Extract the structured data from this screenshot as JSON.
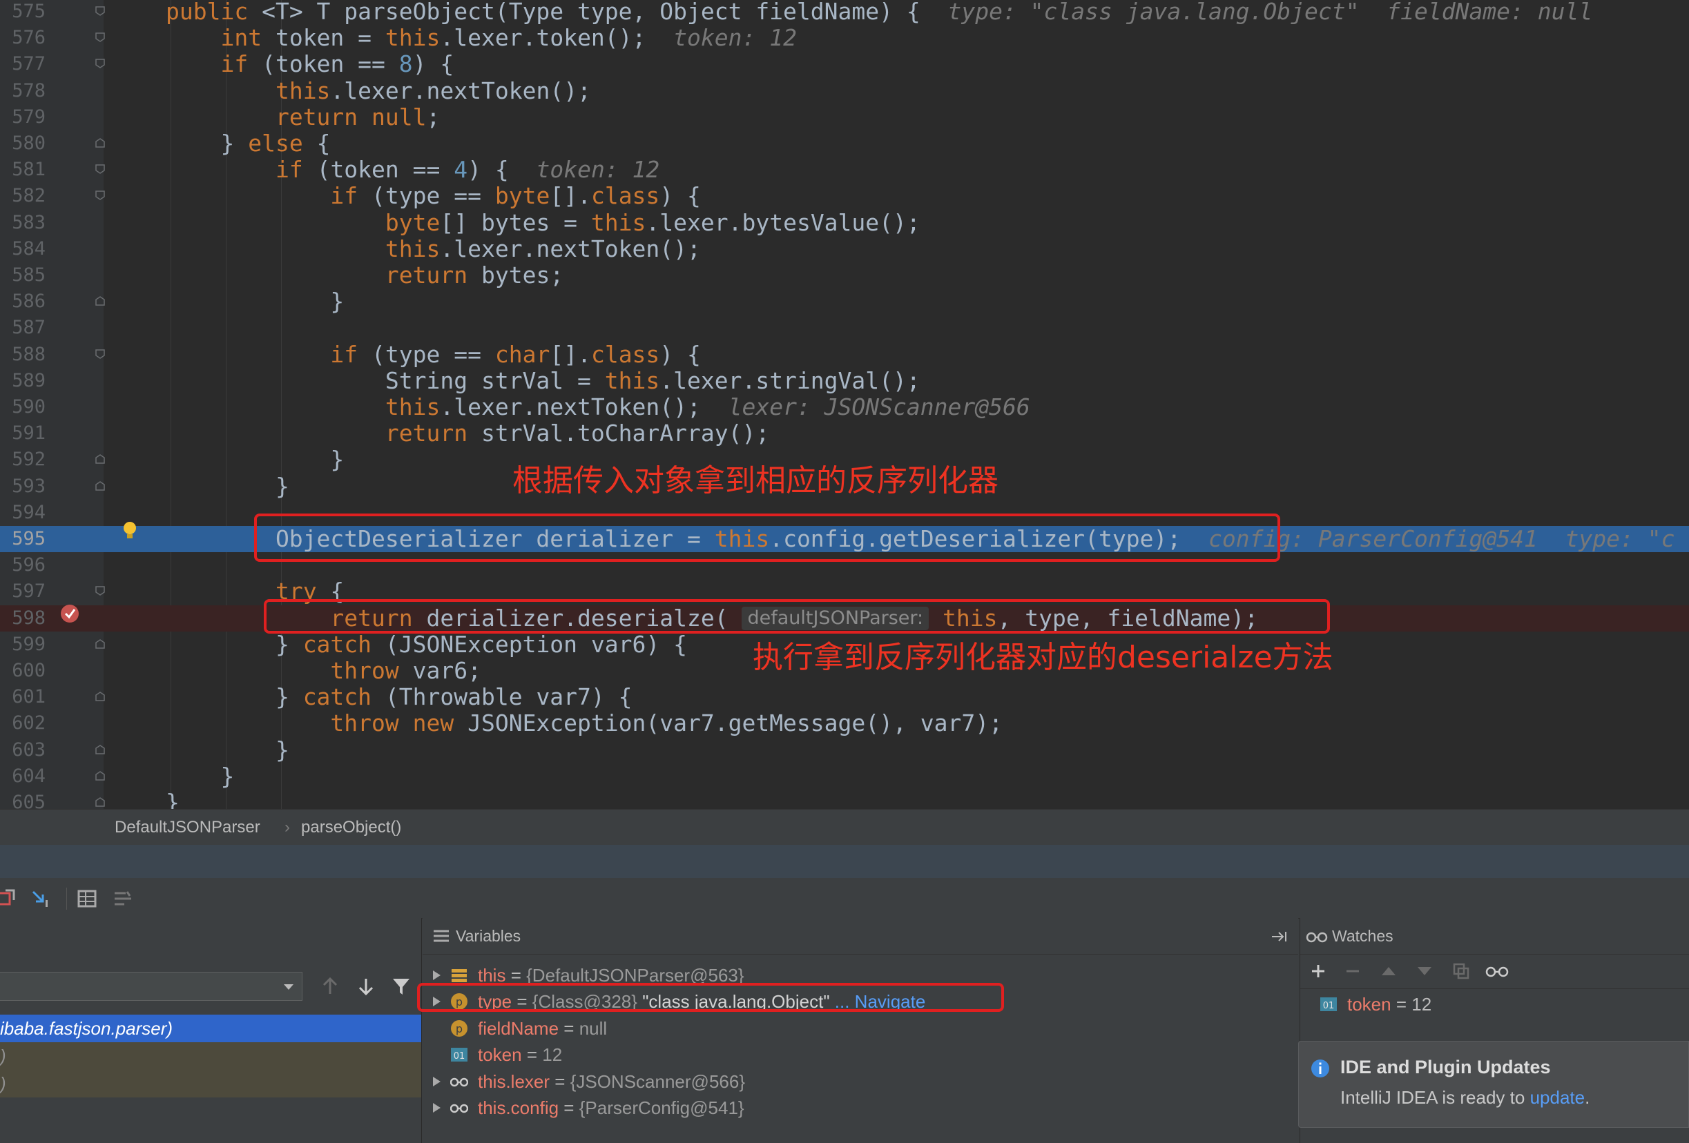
{
  "editor": {
    "lines": [
      {
        "n": "575",
        "tokens": [
          [
            "kw",
            "public "
          ],
          [
            "pl",
            "<T> T parseObject(Type type, Object fieldName) {  "
          ],
          [
            "hint",
            "type: \"class java.lang.Object\"  fieldName: null"
          ]
        ]
      },
      {
        "n": "576",
        "tokens": [
          [
            "pl",
            "    "
          ],
          [
            "kw",
            "int"
          ],
          [
            "pl",
            " token = "
          ],
          [
            "kw",
            "this"
          ],
          [
            "pl",
            ".lexer.token();  "
          ],
          [
            "hint",
            "token: 12"
          ]
        ]
      },
      {
        "n": "577",
        "tokens": [
          [
            "pl",
            "    "
          ],
          [
            "kw",
            "if"
          ],
          [
            "pl",
            " (token == "
          ],
          [
            "num",
            "8"
          ],
          [
            "pl",
            ") {"
          ]
        ]
      },
      {
        "n": "578",
        "tokens": [
          [
            "pl",
            "        "
          ],
          [
            "kw",
            "this"
          ],
          [
            "pl",
            ".lexer.nextToken();"
          ]
        ]
      },
      {
        "n": "579",
        "tokens": [
          [
            "pl",
            "        "
          ],
          [
            "kw",
            "return null"
          ],
          [
            "pl",
            ";"
          ]
        ]
      },
      {
        "n": "580",
        "tokens": [
          [
            "pl",
            "    } "
          ],
          [
            "kw",
            "else"
          ],
          [
            "pl",
            " {"
          ]
        ]
      },
      {
        "n": "581",
        "tokens": [
          [
            "pl",
            "        "
          ],
          [
            "kw",
            "if"
          ],
          [
            "pl",
            " (token == "
          ],
          [
            "num",
            "4"
          ],
          [
            "pl",
            ") {  "
          ],
          [
            "hint",
            "token: 12"
          ]
        ]
      },
      {
        "n": "582",
        "tokens": [
          [
            "pl",
            "            "
          ],
          [
            "kw",
            "if"
          ],
          [
            "pl",
            " (type == "
          ],
          [
            "kw",
            "byte"
          ],
          [
            "pl",
            "[]."
          ],
          [
            "kw",
            "class"
          ],
          [
            "pl",
            ") {"
          ]
        ]
      },
      {
        "n": "583",
        "tokens": [
          [
            "pl",
            "                "
          ],
          [
            "kw",
            "byte"
          ],
          [
            "pl",
            "[] bytes = "
          ],
          [
            "kw",
            "this"
          ],
          [
            "pl",
            ".lexer.bytesValue();"
          ]
        ]
      },
      {
        "n": "584",
        "tokens": [
          [
            "pl",
            "                "
          ],
          [
            "kw",
            "this"
          ],
          [
            "pl",
            ".lexer.nextToken();"
          ]
        ]
      },
      {
        "n": "585",
        "tokens": [
          [
            "pl",
            "                "
          ],
          [
            "kw",
            "return"
          ],
          [
            "pl",
            " bytes;"
          ]
        ]
      },
      {
        "n": "586",
        "tokens": [
          [
            "pl",
            "            }"
          ]
        ]
      },
      {
        "n": "587",
        "tokens": []
      },
      {
        "n": "588",
        "tokens": [
          [
            "pl",
            "            "
          ],
          [
            "kw",
            "if"
          ],
          [
            "pl",
            " (type == "
          ],
          [
            "kw",
            "char"
          ],
          [
            "pl",
            "[]."
          ],
          [
            "kw",
            "class"
          ],
          [
            "pl",
            ") {"
          ]
        ]
      },
      {
        "n": "589",
        "tokens": [
          [
            "pl",
            "                String strVal = "
          ],
          [
            "kw",
            "this"
          ],
          [
            "pl",
            ".lexer.stringVal();"
          ]
        ]
      },
      {
        "n": "590",
        "tokens": [
          [
            "pl",
            "                "
          ],
          [
            "kw",
            "this"
          ],
          [
            "pl",
            ".lexer.nextToken();  "
          ],
          [
            "hint",
            "lexer: JSONScanner@566"
          ]
        ]
      },
      {
        "n": "591",
        "tokens": [
          [
            "pl",
            "                "
          ],
          [
            "kw",
            "return"
          ],
          [
            "pl",
            " strVal.toCharArray();"
          ]
        ]
      },
      {
        "n": "592",
        "tokens": [
          [
            "pl",
            "            }"
          ]
        ]
      },
      {
        "n": "593",
        "tokens": [
          [
            "pl",
            "        }"
          ]
        ]
      },
      {
        "n": "594",
        "tokens": []
      },
      {
        "n": "595",
        "tokens": [
          [
            "pl",
            "        ObjectDeserializer derializer = "
          ],
          [
            "kw",
            "this"
          ],
          [
            "pl",
            ".config.getDeserializer(type);  "
          ],
          [
            "hint",
            "config: ParserConfig@541  type: \"c"
          ]
        ]
      },
      {
        "n": "596",
        "tokens": []
      },
      {
        "n": "597",
        "tokens": [
          [
            "pl",
            "        "
          ],
          [
            "kw",
            "try"
          ],
          [
            "pl",
            " {"
          ]
        ]
      },
      {
        "n": "598",
        "tokens": [
          [
            "pl",
            "            "
          ],
          [
            "kw",
            "return"
          ],
          [
            "pl",
            " derializer.deserialze( "
          ],
          [
            "phint",
            "defaultJSONParser:"
          ],
          [
            "kw",
            " this"
          ],
          [
            "pl",
            ", type, fieldName);"
          ]
        ]
      },
      {
        "n": "599",
        "tokens": [
          [
            "pl",
            "        } "
          ],
          [
            "kw",
            "catch"
          ],
          [
            "pl",
            " (JSONException var6) {"
          ]
        ]
      },
      {
        "n": "600",
        "tokens": [
          [
            "pl",
            "            "
          ],
          [
            "kw",
            "throw"
          ],
          [
            "pl",
            " var6;"
          ]
        ]
      },
      {
        "n": "601",
        "tokens": [
          [
            "pl",
            "        } "
          ],
          [
            "kw",
            "catch"
          ],
          [
            "pl",
            " (Throwable var7) {"
          ]
        ]
      },
      {
        "n": "602",
        "tokens": [
          [
            "pl",
            "            "
          ],
          [
            "kw",
            "throw new"
          ],
          [
            "pl",
            " JSONException(var7.getMessage(), var7);"
          ]
        ]
      },
      {
        "n": "603",
        "tokens": [
          [
            "pl",
            "        }"
          ]
        ]
      },
      {
        "n": "604",
        "tokens": [
          [
            "pl",
            "    }"
          ]
        ]
      },
      {
        "n": "605",
        "tokens": [
          [
            "pl",
            "}"
          ]
        ]
      }
    ],
    "annotation_1": "根据传入对象拿到相应的反序列化器",
    "annotation_2": "执行拿到反序列化器对应的deserialze方法"
  },
  "breadcrumb": {
    "class": "DefaultJSONParser",
    "separator": "›",
    "method": "parseObject()"
  },
  "frames": {
    "items": [
      {
        "label": "ibaba.fastjson.parser)",
        "state": "selected"
      },
      {
        "label": ")",
        "state": "library"
      },
      {
        "label": ")",
        "state": "library"
      }
    ]
  },
  "variables": {
    "title": "Variables",
    "rows": [
      {
        "icon": "field-icon",
        "expand": true,
        "name": "this",
        "eq": " = ",
        "val": "{DefaultJSONParser@563}",
        "str": "",
        "link": ""
      },
      {
        "icon": "param-icon",
        "expand": true,
        "name": "type",
        "eq": " = ",
        "val": "{Class@328} ",
        "str": "\"class java.lang.Object\"",
        "link": " ... Navigate"
      },
      {
        "icon": "param-icon",
        "expand": false,
        "name": "fieldName",
        "eq": " = ",
        "val": "null",
        "str": "",
        "link": ""
      },
      {
        "icon": "primitive-icon",
        "expand": false,
        "name": "token",
        "eq": " = ",
        "val": "12",
        "str": "",
        "link": ""
      },
      {
        "icon": "watch-glasses-icon",
        "expand": true,
        "name": "this.lexer",
        "eq": " = ",
        "val": "{JSONScanner@566}",
        "str": "",
        "link": ""
      },
      {
        "icon": "watch-glasses-icon",
        "expand": true,
        "name": "this.config",
        "eq": " = ",
        "val": "{ParserConfig@541}",
        "str": "",
        "link": ""
      }
    ]
  },
  "watches": {
    "title": "Watches",
    "items": [
      {
        "name": "token",
        "eq": " = ",
        "val": "12"
      }
    ]
  },
  "notification": {
    "title": "IDE and Plugin Updates",
    "body": "IntelliJ IDEA is ready to ",
    "link": "update",
    "suffix": "."
  },
  "colors": {
    "editor_bg": "#2b2b2b",
    "keyword": "#cc7832",
    "number": "#6897bb",
    "execution_line": "#2d6099",
    "breakpoint_line": "#3a2323",
    "annotation": "#ee3322",
    "selection": "#2f65ca"
  }
}
